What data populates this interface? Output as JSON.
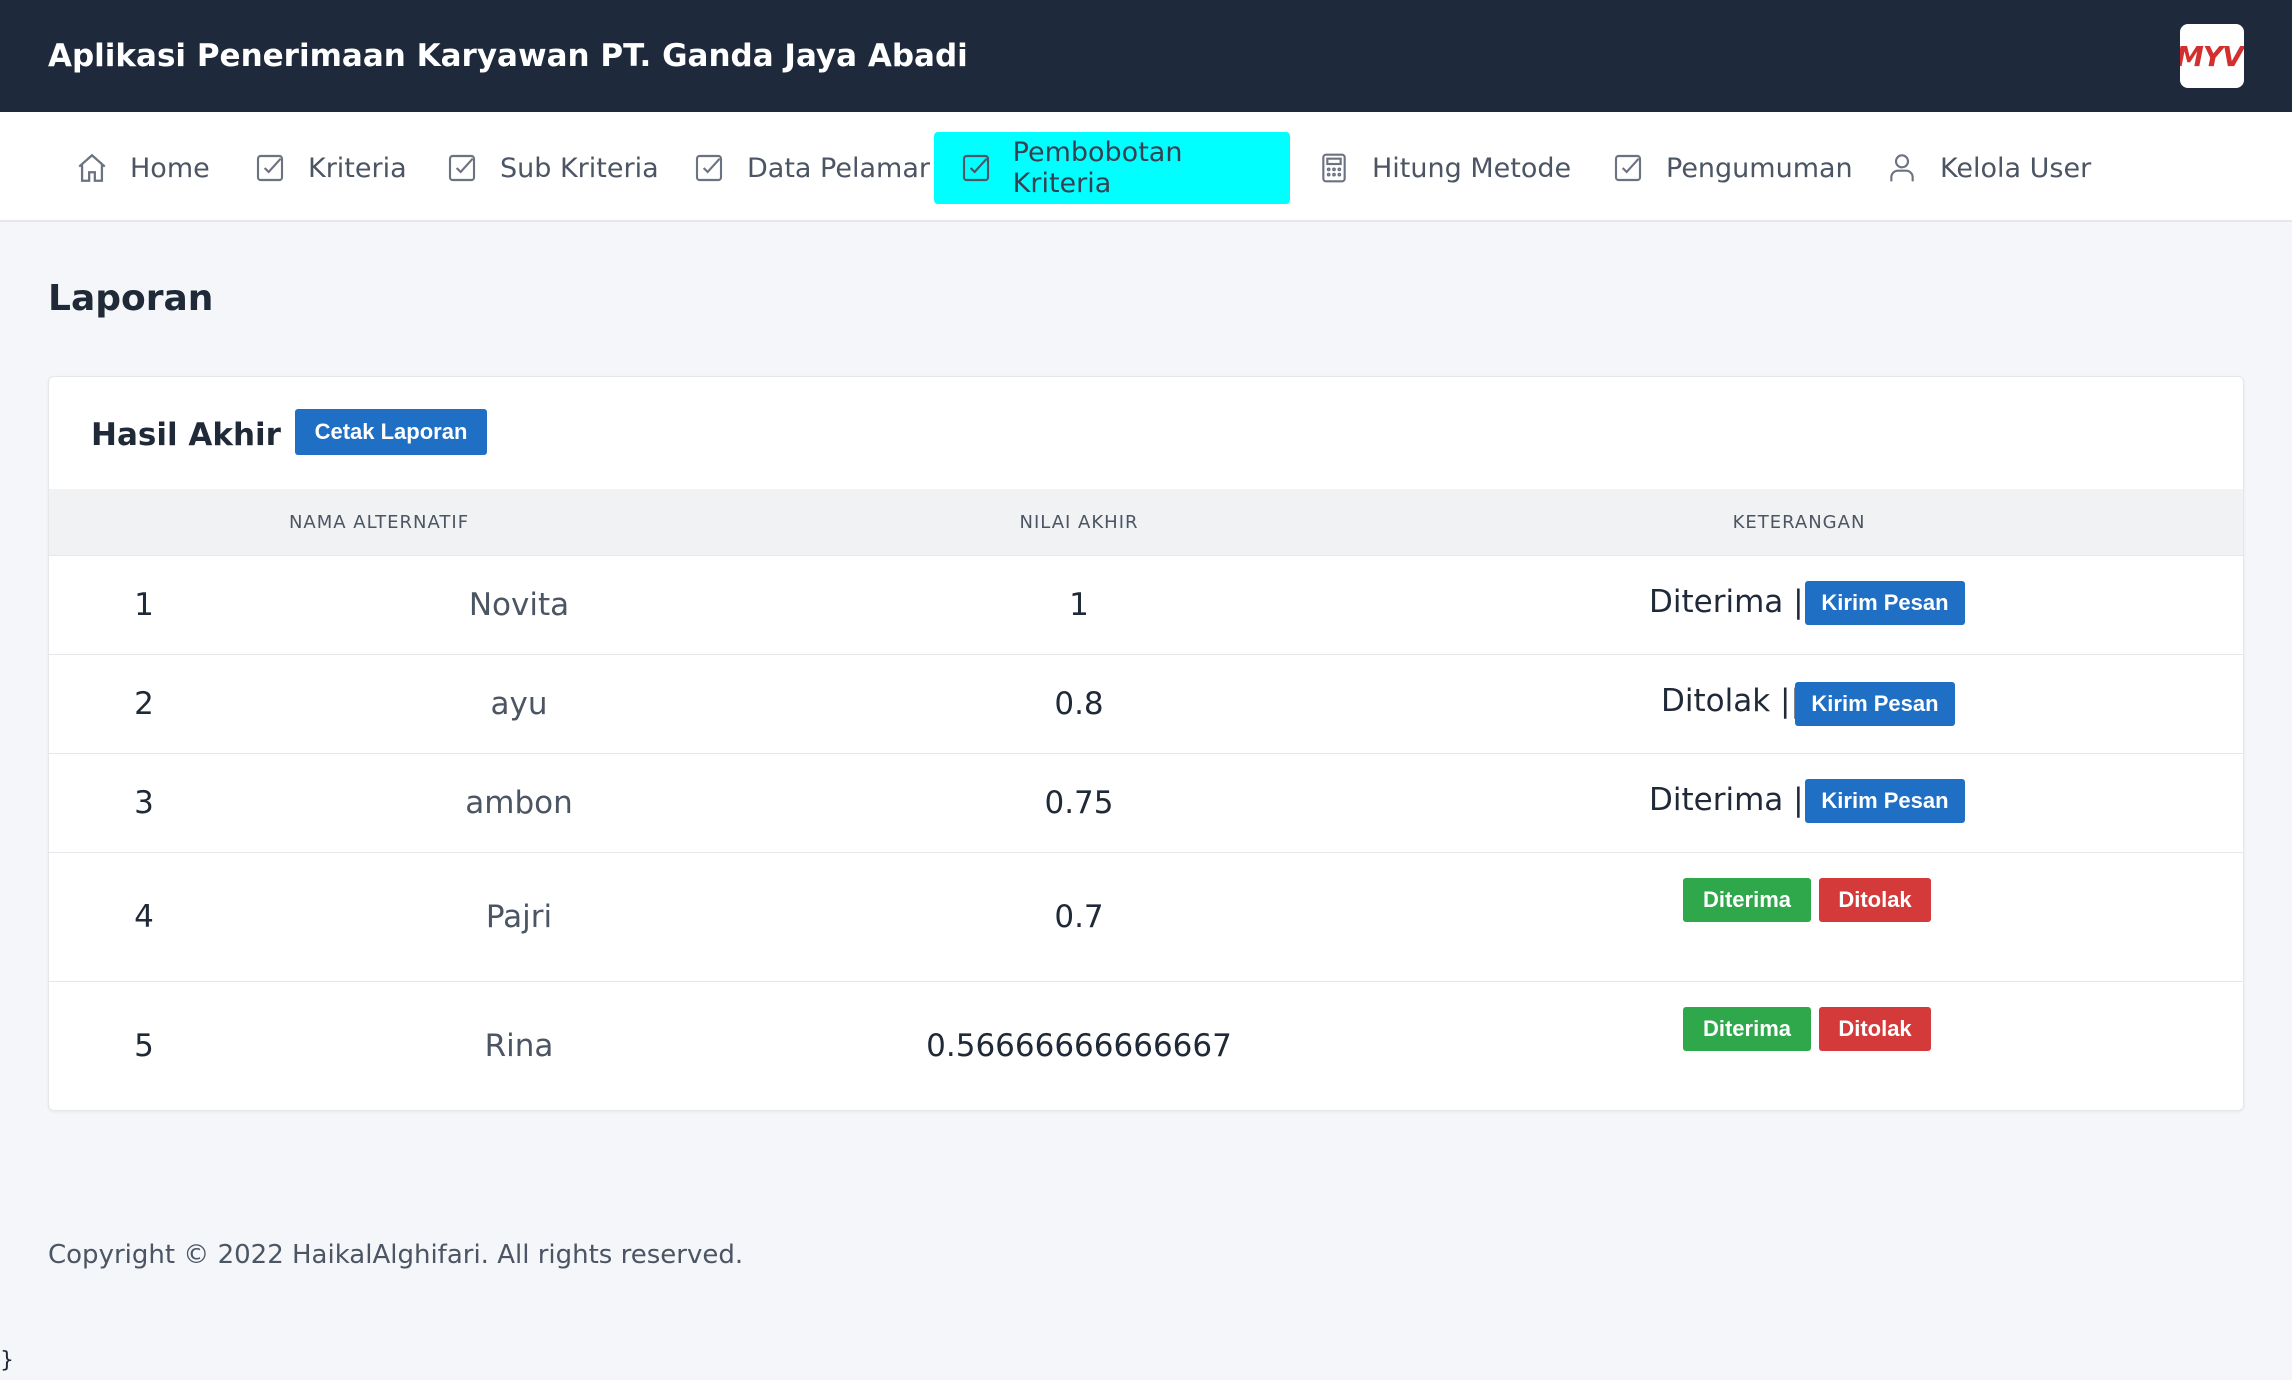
{
  "header": {
    "app_title": "Aplikasi Penerimaan Karyawan PT. Ganda Jaya Abadi",
    "logo_text": "MYV"
  },
  "nav": {
    "items": [
      {
        "label": "Home",
        "icon": "home-icon"
      },
      {
        "label": "Kriteria",
        "icon": "checkbox-icon"
      },
      {
        "label": "Sub Kriteria",
        "icon": "checkbox-icon"
      },
      {
        "label": "Data Pelamar",
        "icon": "checkbox-icon"
      },
      {
        "label": "Pembobotan Kriteria",
        "icon": "checkbox-icon",
        "active": true
      },
      {
        "label": "Hitung Metode",
        "icon": "calculator-icon"
      },
      {
        "label": "Pengumuman",
        "icon": "checkbox-icon"
      },
      {
        "label": "Kelola User",
        "icon": "user-icon"
      }
    ],
    "active_color": "#00ffff"
  },
  "page": {
    "heading": "Laporan"
  },
  "card": {
    "title": "Hasil Akhir",
    "print_button": "Cetak Laporan",
    "columns": [
      "NAMA ALTERNATIF",
      "NILAI AKHIR",
      "KETERANGAN"
    ],
    "rows": [
      {
        "no": "1",
        "name": "Novita",
        "value": "1",
        "status": "Diterima ||",
        "action": "Kirim Pesan"
      },
      {
        "no": "2",
        "name": "ayu",
        "value": "0.8",
        "status": "Ditolak ||",
        "action": "Kirim Pesan"
      },
      {
        "no": "3",
        "name": "ambon",
        "value": "0.75",
        "status": "Diterima ||",
        "action": "Kirim Pesan"
      },
      {
        "no": "4",
        "name": "Pajri",
        "value": "0.7",
        "accept": "Diterima",
        "reject": "Ditolak"
      },
      {
        "no": "5",
        "name": "Rina",
        "value": "0.56666666666667",
        "accept": "Diterima",
        "reject": "Ditolak"
      }
    ]
  },
  "footer": {
    "copyright": "Copyright © 2022 HaikalAlghifari. All rights reserved."
  },
  "stray_text": "}",
  "colors": {
    "topbar": "#1e293b",
    "primary": "#1f6fc5",
    "success": "#2ea84a",
    "danger": "#d43a3a"
  }
}
